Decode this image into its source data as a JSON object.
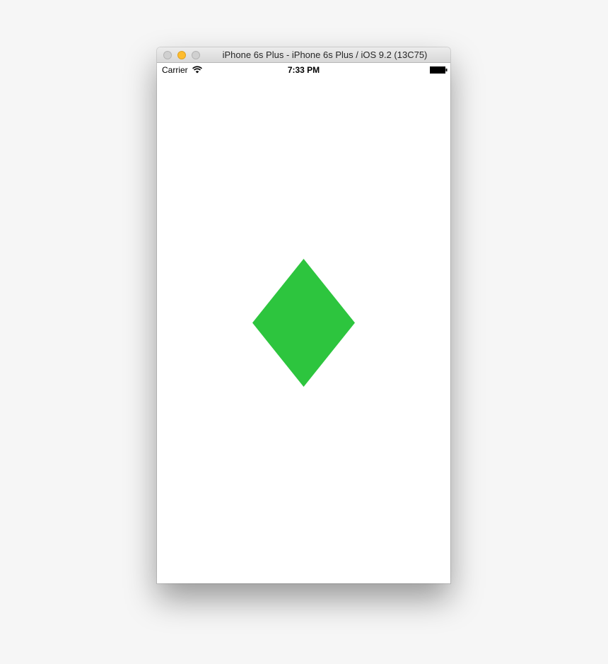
{
  "window": {
    "title": "iPhone 6s Plus - iPhone 6s Plus / iOS 9.2 (13C75)"
  },
  "status_bar": {
    "carrier": "Carrier",
    "time": "7:33 PM"
  },
  "icons": {
    "wifi": "wifi-icon",
    "battery": "battery-icon"
  },
  "colors": {
    "diamond": "#2dc53e",
    "minimize_button": "#febc2e"
  }
}
